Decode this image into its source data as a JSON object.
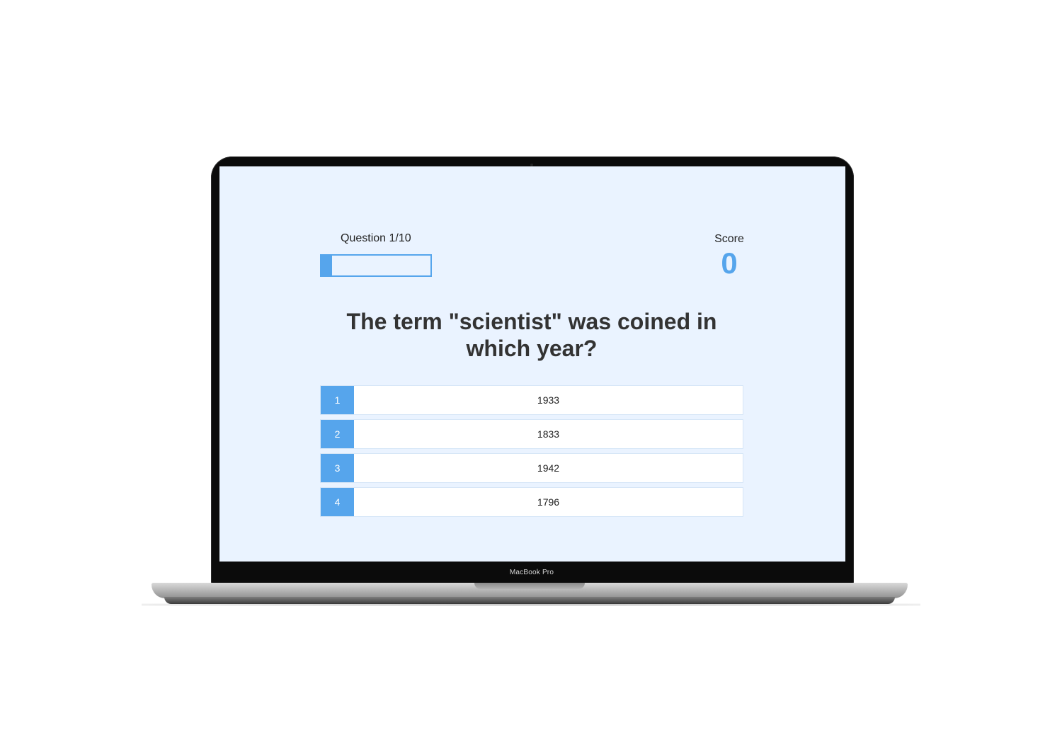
{
  "device": {
    "label": "MacBook Pro"
  },
  "quiz": {
    "progress_text": "Question 1/10",
    "progress_fraction": 0.1,
    "score_label": "Score",
    "score_value": "0",
    "question": "The term \"scientist\" was coined in which year?",
    "choices": [
      {
        "prefix": "1",
        "text": "1933"
      },
      {
        "prefix": "2",
        "text": "1833"
      },
      {
        "prefix": "3",
        "text": "1942"
      },
      {
        "prefix": "4",
        "text": "1796"
      }
    ]
  },
  "colors": {
    "accent": "#56a5ec",
    "screen_background": "#eaf3ff",
    "text": "#333333"
  }
}
